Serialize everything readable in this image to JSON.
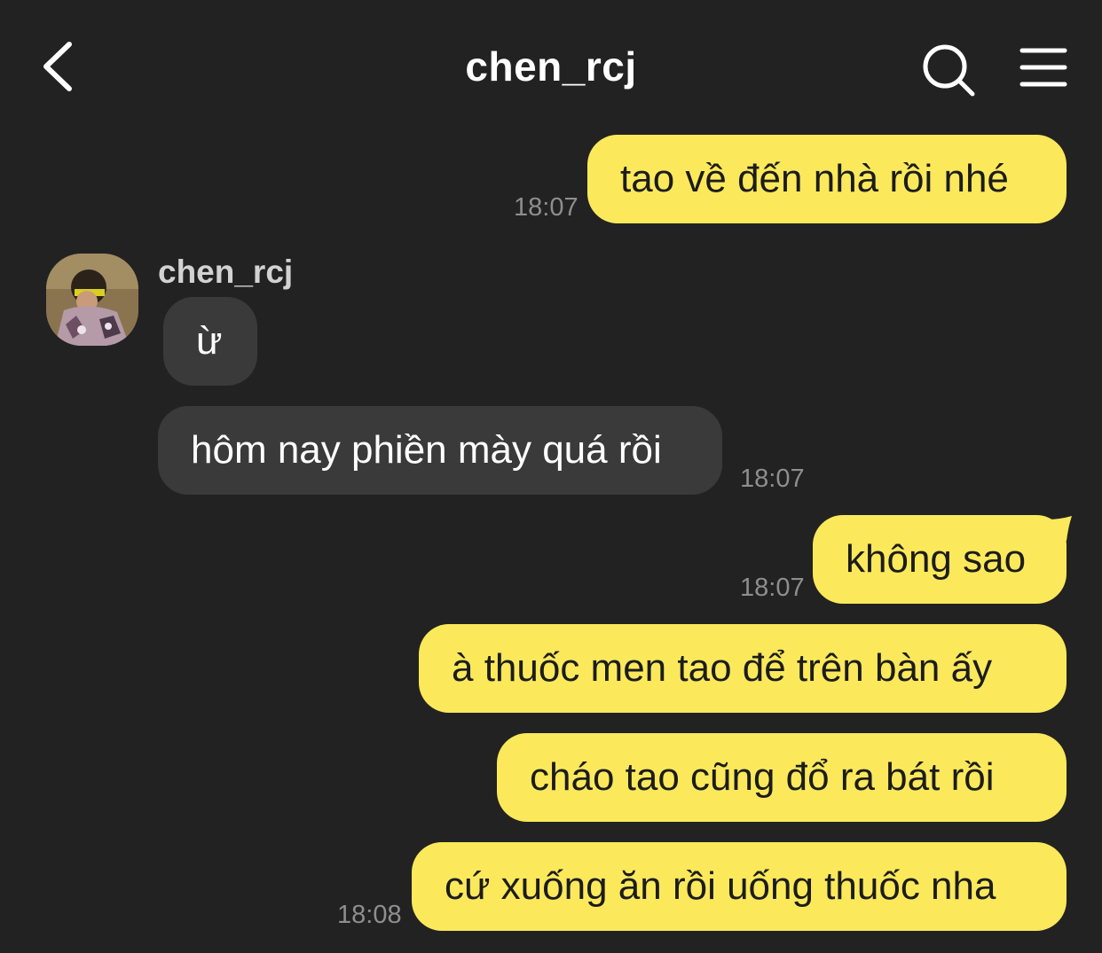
{
  "header": {
    "title": "chen_rcj",
    "icons": {
      "back": "chevron-left-icon",
      "search": "search-icon",
      "menu": "hamburger-menu-icon"
    }
  },
  "colors": {
    "background": "#222222",
    "my_bubble": "#fbe95b",
    "their_bubble": "#3a3a3a",
    "timestamp": "#8e8e8e"
  },
  "chat": {
    "contact_name": "chen_rcj",
    "messages": [
      {
        "sender": "me",
        "text": "tao về đến nhà rồi nhé",
        "time": "18:07"
      },
      {
        "sender": "them",
        "text": "ừ",
        "time": ""
      },
      {
        "sender": "them",
        "text": "hôm nay phiền mày quá rồi",
        "time": "18:07"
      },
      {
        "sender": "me",
        "text": "không sao",
        "time": "18:07"
      },
      {
        "sender": "me",
        "text": "à thuốc men tao để trên bàn ấy",
        "time": ""
      },
      {
        "sender": "me",
        "text": "cháo tao cũng đổ ra bát rồi",
        "time": ""
      },
      {
        "sender": "me",
        "text": "cứ xuống ăn rồi uống thuốc nha",
        "time": "18:08"
      }
    ]
  }
}
